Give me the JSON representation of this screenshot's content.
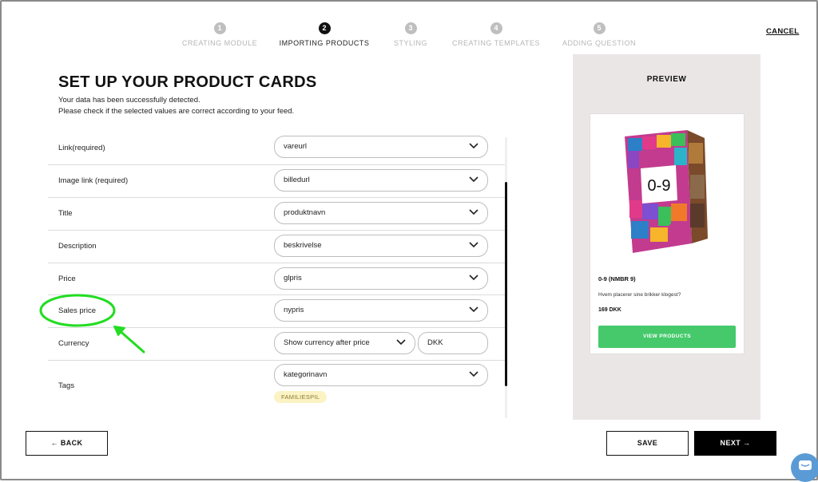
{
  "steps": [
    {
      "num": "1",
      "label": "CREATING MODULE"
    },
    {
      "num": "2",
      "label": "IMPORTING PRODUCTS"
    },
    {
      "num": "3",
      "label": "STYLING"
    },
    {
      "num": "4",
      "label": "CREATING TEMPLATES"
    },
    {
      "num": "5",
      "label": "ADDING QUESTION"
    }
  ],
  "active_step": 2,
  "cancel_label": "CANCEL",
  "page": {
    "title": "SET UP YOUR PRODUCT CARDS",
    "subtitle_line1": "Your data has been successfully detected.",
    "subtitle_line2": "Please check if the selected values are correct according to your feed."
  },
  "fields": [
    {
      "label": "Link(required)",
      "value": "vareurl"
    },
    {
      "label": "Image link (required)",
      "value": "billedurl"
    },
    {
      "label": "Title",
      "value": "produktnavn"
    },
    {
      "label": "Description",
      "value": "beskrivelse"
    },
    {
      "label": "Price",
      "value": "glpris"
    },
    {
      "label": "Sales price",
      "value": "nypris"
    },
    {
      "label": "Currency",
      "value": "Show currency after price",
      "extra_value": "DKK"
    },
    {
      "label": "Tags",
      "value": "kategorinavn",
      "tag": "FAMILIESPIL"
    }
  ],
  "preview": {
    "title": "PREVIEW",
    "product_name": "0-9 (NMBR 9)",
    "product_desc": "Hvem placerer sine brikker klogest?",
    "product_price": "169 DKK",
    "button_label": "VIEW PRODUCTS",
    "box_text": "0-9"
  },
  "footer": {
    "back_label": "← BACK",
    "save_label": "SAVE",
    "next_label": "NEXT →"
  },
  "colors": {
    "accent_green": "#45c96b",
    "annotation_green": "#22dd22",
    "tag_bg": "#fbf3c4",
    "preview_bg": "#ebe6e6"
  }
}
